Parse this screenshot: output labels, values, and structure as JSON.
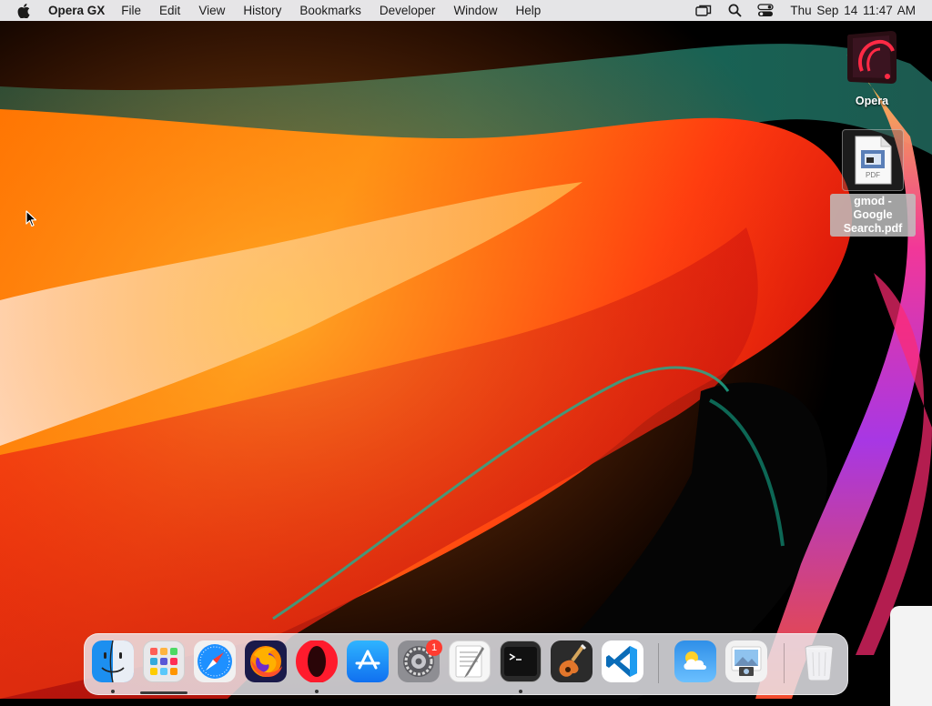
{
  "menubar": {
    "apple_icon": "apple-icon",
    "app_name": "Opera GX",
    "items": [
      "File",
      "Edit",
      "View",
      "History",
      "Bookmarks",
      "Developer",
      "Window",
      "Help"
    ],
    "status_icons": [
      "screen-mirroring-icon",
      "spotlight-search-icon",
      "control-center-icon"
    ],
    "clock": "Thu Sep 14  11:47 AM"
  },
  "desktop": {
    "icons": [
      {
        "label": "Opera",
        "icon": "opera-gx-app-icon"
      },
      {
        "label": "gmod - Google Search.pdf",
        "icon": "pdf-document-icon",
        "badge_text": "PDF",
        "selected": true
      }
    ]
  },
  "dock": {
    "apps": [
      {
        "name": "Finder",
        "icon": "finder-icon",
        "running": true
      },
      {
        "name": "Launchpad",
        "icon": "launchpad-icon",
        "running": false
      },
      {
        "name": "Safari",
        "icon": "safari-icon",
        "running": false
      },
      {
        "name": "Firefox",
        "icon": "firefox-icon",
        "running": false
      },
      {
        "name": "Opera GX",
        "icon": "opera-icon",
        "running": true
      },
      {
        "name": "App Store",
        "icon": "app-store-icon",
        "running": false
      },
      {
        "name": "System Settings",
        "icon": "system-settings-icon",
        "running": false,
        "badge": "1"
      },
      {
        "name": "TextEdit",
        "icon": "textedit-icon",
        "running": false
      },
      {
        "name": "Terminal",
        "icon": "terminal-icon",
        "running": true
      },
      {
        "name": "GarageBand",
        "icon": "garageband-icon",
        "running": false
      },
      {
        "name": "Visual Studio Code",
        "icon": "vscode-icon",
        "running": false
      }
    ],
    "recent": [
      {
        "name": "Weather",
        "icon": "weather-icon"
      },
      {
        "name": "Preview",
        "icon": "preview-icon"
      }
    ],
    "trash": {
      "name": "Trash",
      "icon": "trash-icon"
    }
  },
  "colors": {
    "menubar_bg": "#ececee",
    "badge_red": "#ff3b30",
    "opera_red": "#ff1b2d",
    "vscode_blue": "#007acc"
  }
}
